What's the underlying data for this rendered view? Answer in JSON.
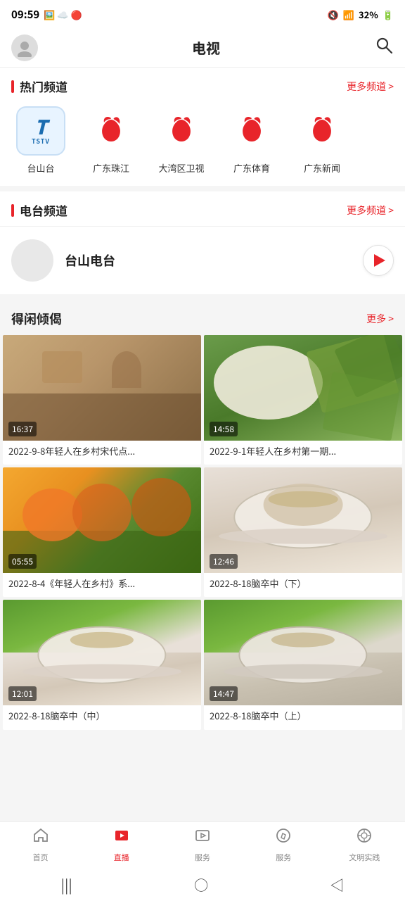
{
  "statusBar": {
    "time": "09:59",
    "battery": "32%",
    "signal": "4G"
  },
  "header": {
    "title": "电视",
    "searchLabel": "搜索"
  },
  "hotChannels": {
    "sectionTitle": "热门频道",
    "moreLabel": "更多频道 >",
    "channels": [
      {
        "id": "tstv",
        "name": "台山台",
        "type": "tstv"
      },
      {
        "id": "gdpj",
        "name": "广东珠江",
        "type": "bird"
      },
      {
        "id": "daw",
        "name": "大湾区卫视",
        "type": "bird"
      },
      {
        "id": "gdty",
        "name": "广东体育",
        "type": "bird"
      },
      {
        "id": "gdxw",
        "name": "广东新闻",
        "type": "bird"
      }
    ]
  },
  "radioChannels": {
    "sectionTitle": "电台频道",
    "moreLabel": "更多频道 >",
    "stations": [
      {
        "id": "tsdt",
        "name": "台山电台"
      }
    ]
  },
  "videoSection": {
    "sectionTitle": "得闲倾偈",
    "moreLabel": "更多 >",
    "videos": [
      {
        "id": "v1",
        "duration": "16:37",
        "title": "2022-9-8年轻人在乡村宋代点...",
        "thumbType": "tea-room"
      },
      {
        "id": "v2",
        "duration": "14:58",
        "title": "2022-9-1年轻人在乡村第一期...",
        "thumbType": "tea-leaf"
      },
      {
        "id": "v3",
        "duration": "05:55",
        "title": "2022-8-4《年轻人在乡村》系...",
        "thumbType": "green-picking"
      },
      {
        "id": "v4",
        "duration": "12:46",
        "title": "2022-8-18脑卒中（下）",
        "thumbType": "white-cup"
      },
      {
        "id": "v5",
        "duration": "12:01",
        "title": "2022-8-18脑卒中（中）",
        "thumbType": "cup-2"
      },
      {
        "id": "v6",
        "duration": "14:47",
        "title": "2022-8-18脑卒中（上）",
        "thumbType": "cup-3"
      }
    ]
  },
  "bottomNav": {
    "items": [
      {
        "id": "home",
        "label": "首页",
        "icon": "⌂",
        "active": false
      },
      {
        "id": "live",
        "label": "直播",
        "icon": "▶",
        "active": true
      },
      {
        "id": "service",
        "label": "服务",
        "icon": "▷",
        "active": false
      },
      {
        "id": "discover",
        "label": "服务",
        "icon": "◎",
        "active": false
      },
      {
        "id": "culture",
        "label": "文明实践",
        "icon": "⊕",
        "active": false
      }
    ]
  }
}
